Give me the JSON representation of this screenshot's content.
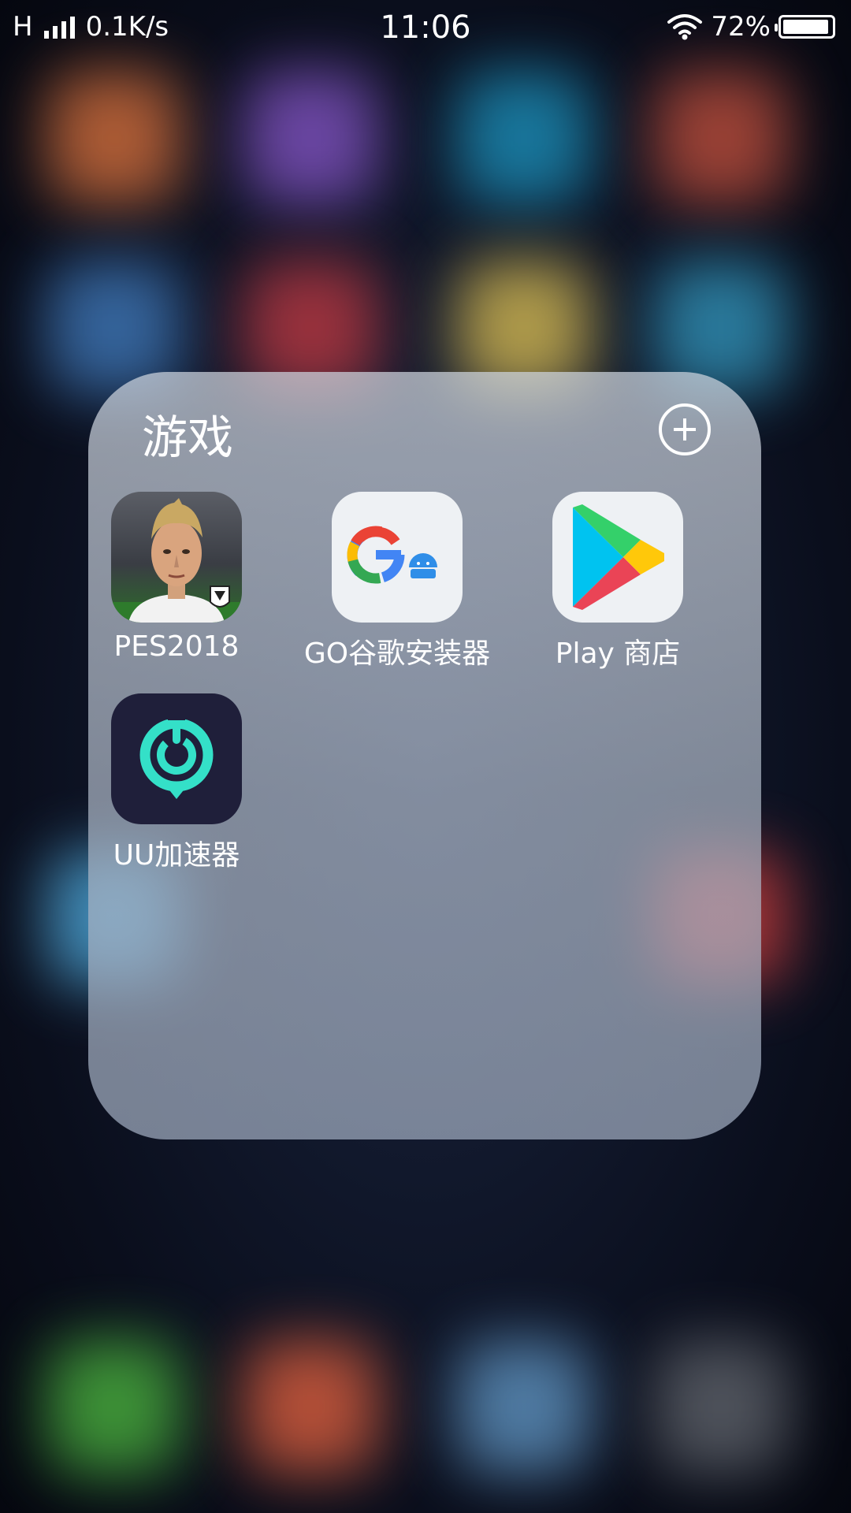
{
  "status_bar": {
    "network_type": "H",
    "net_speed": "0.1K/s",
    "time": "11:06",
    "battery_percent": "72%",
    "battery_level": 0.95
  },
  "folder": {
    "title": "游戏",
    "apps": [
      {
        "label": "PES2018",
        "icon": "pes2018-app-icon"
      },
      {
        "label": "GO谷歌安装器",
        "icon": "go-google-installer-icon"
      },
      {
        "label": "Play 商店",
        "icon": "google-play-icon"
      },
      {
        "label": "UU加速器",
        "icon": "uu-accelerator-icon"
      }
    ]
  },
  "colors": {
    "uu_teal": "#34e0c8",
    "uu_bg": "#1f1f3a",
    "google_blue": "#4285f4",
    "google_red": "#ea4335",
    "google_yellow": "#fbbc05",
    "google_green": "#34a853"
  }
}
